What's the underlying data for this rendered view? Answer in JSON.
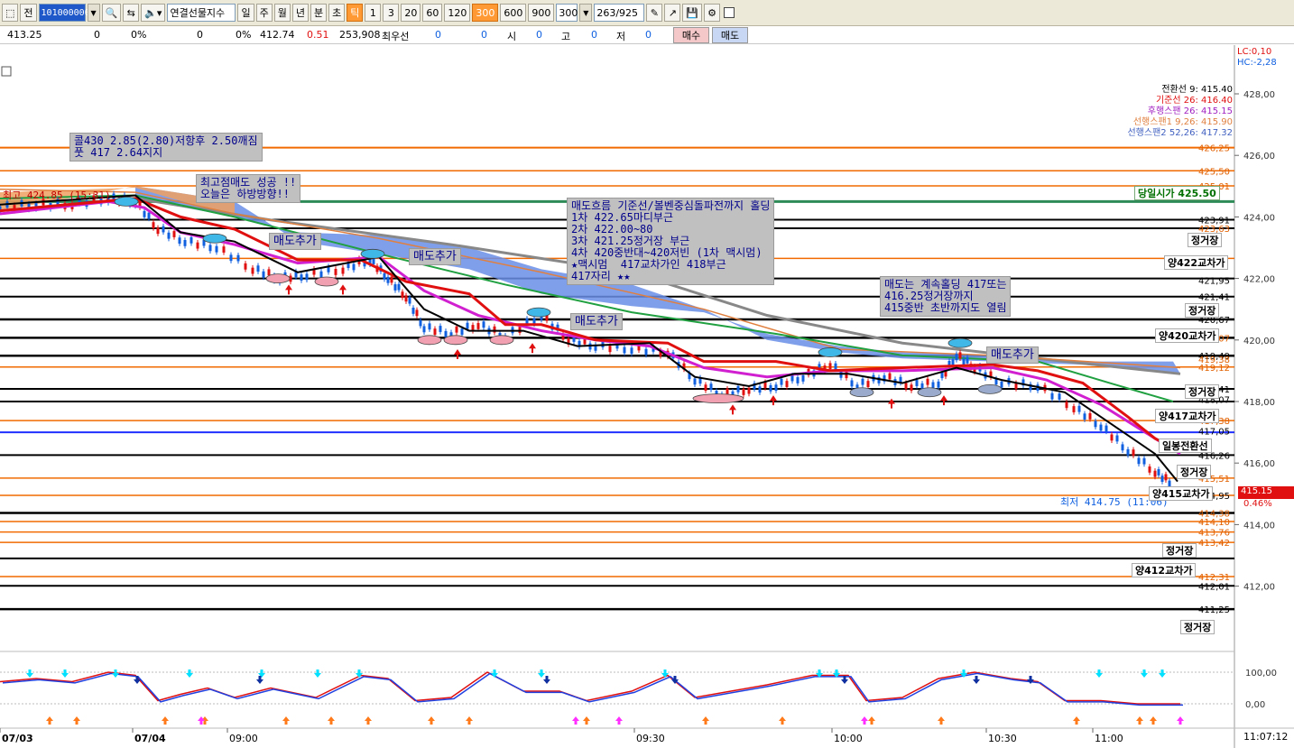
{
  "toolbar": {
    "prev_label": "전",
    "code": "101000000",
    "name": "연결선물지수",
    "periods": [
      "일",
      "주",
      "월",
      "년",
      "분",
      "초",
      "틱"
    ],
    "active_period": "틱",
    "intervals": [
      "1",
      "3",
      "20",
      "60",
      "120",
      "300",
      "600",
      "900"
    ],
    "active_interval": "300",
    "interval_value": "300",
    "page": "263/925"
  },
  "quote": {
    "price": "413.25",
    "v1": "0",
    "p1": "0%",
    "v2": "0",
    "p2": "0%",
    "base": "412.74",
    "change": "0.51",
    "volume": "253,908",
    "best_label": "최우선",
    "best1": "0",
    "best2": "0",
    "open_label": "시",
    "open": "0",
    "high_label": "고",
    "high": "0",
    "low_label": "저",
    "low": "0",
    "buy_label": "매수",
    "sell_label": "매도"
  },
  "lc_label": "LC:0,10",
  "hc_label": "HC:-2,28",
  "legend": [
    {
      "text": "전환선 9: 415.40",
      "color": "#000000"
    },
    {
      "text": "기준선 26: 416.40",
      "color": "#e01010"
    },
    {
      "text": "후행스팬 26: 415.15",
      "color": "#a020c0"
    },
    {
      "text": "선행스팬1 9,26: 415.90",
      "color": "#e08040"
    },
    {
      "text": "선행스팬2 52,26: 417.32",
      "color": "#4060c0"
    }
  ],
  "annotations": {
    "call_put": "콜430 2.85(2.80)저항후 2.50깨짐\n풋 417 2.64지지",
    "top_sell": "최고점매도 성공 !!\n오늘은 하방방향!!",
    "sell_add1": "매도추가",
    "sell_add2": "매도추가",
    "sell_add3": "매도추가",
    "sell_add4": "매도추가",
    "sell_flow": "매도흐름 기준선/볼벤중심돌파전까지 홀딩\n1차 422.65마디부근\n2차 422.00~80\n3차 421.25정거장 부근\n4차 420중반대~420저빈 (1차 맥시멈)\n★맥시멈  417교차가인 418부근\n417자리 ★★",
    "keep_hold": "매도는 계속홀딩 417또는\n416.25정거장까지\n415중반 초반까지도 열림",
    "high_text": "최고 424.85 (15:31)",
    "low_text": "최저 414.75 (11:06)"
  },
  "level_labels": {
    "today_open": "당일시가 425.50",
    "station1": "정거장",
    "cross422": "양422교차가",
    "station2": "정거장",
    "cross420": "양420교차가",
    "station3": "정거장",
    "cross417": "양417교차가",
    "daily_conv": "일봉전환선",
    "station4": "정거장",
    "cross415": "양415교차가",
    "station5": "정거장",
    "cross412": "양412교차가",
    "station6": "정거장"
  },
  "price_axis": [
    "428,00",
    "426,00",
    "424,00",
    "422,00",
    "420,00",
    "418,00",
    "416,00",
    "414,00",
    "412,00"
  ],
  "level_values": [
    "426.25",
    "425.50",
    "425.01",
    "423.91",
    "423.63",
    "421.95",
    "421.41",
    "420.67",
    "420.07",
    "419.49",
    "419.38",
    "419.12",
    "418.41",
    "418.07",
    "417.38",
    "417.05",
    "416.26",
    "415.51",
    "414.95",
    "414.38",
    "414.10",
    "413.76",
    "413.42",
    "412.31",
    "412.01",
    "411.25"
  ],
  "current_price": "415.15",
  "current_pct": "0.46%",
  "osc_axis": [
    "100,00",
    "0,00"
  ],
  "time_labels": [
    "07/03",
    "07/04",
    "09:00",
    "09:30",
    "10:00",
    "10:30",
    "11:00"
  ],
  "clock": "11:07:12",
  "colors": {
    "up": "#e01010",
    "down": "#1060e0",
    "cloud": "#6a8ee8",
    "cloud_orange": "#f0a060",
    "orange_line": "#f06a00",
    "blue_line": "#2030ff",
    "green_line": "#20a040",
    "gray_line": "#888888"
  }
}
